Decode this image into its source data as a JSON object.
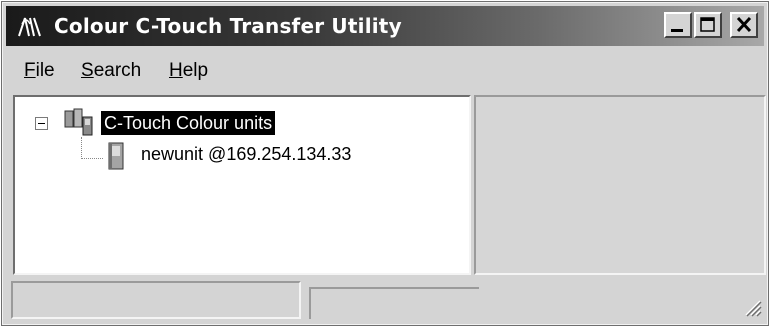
{
  "window": {
    "title": "Colour C-Touch Transfer Utility",
    "icons": {
      "app": "antenna-icon",
      "minimize": "minimize-icon",
      "maximize": "maximize-icon",
      "close": "close-icon"
    }
  },
  "menu": {
    "items": [
      {
        "accel": "F",
        "rest": "ile"
      },
      {
        "accel": "S",
        "rest": "earch"
      },
      {
        "accel": "H",
        "rest": "elp"
      }
    ]
  },
  "tree": {
    "root": {
      "label": "C-Touch Colour units",
      "expanded": true,
      "selected": true,
      "icon": "unit-group-icon"
    },
    "children": [
      {
        "label": "newunit @169.254.134.33",
        "icon": "unit-icon"
      }
    ]
  },
  "status": {
    "pane1": "",
    "pane2": ""
  },
  "colors": {
    "title_gradient_start": "#1a1a1a",
    "title_gradient_end": "#a8a8a8",
    "face": "#d4d4d4",
    "selection": "#000000"
  }
}
